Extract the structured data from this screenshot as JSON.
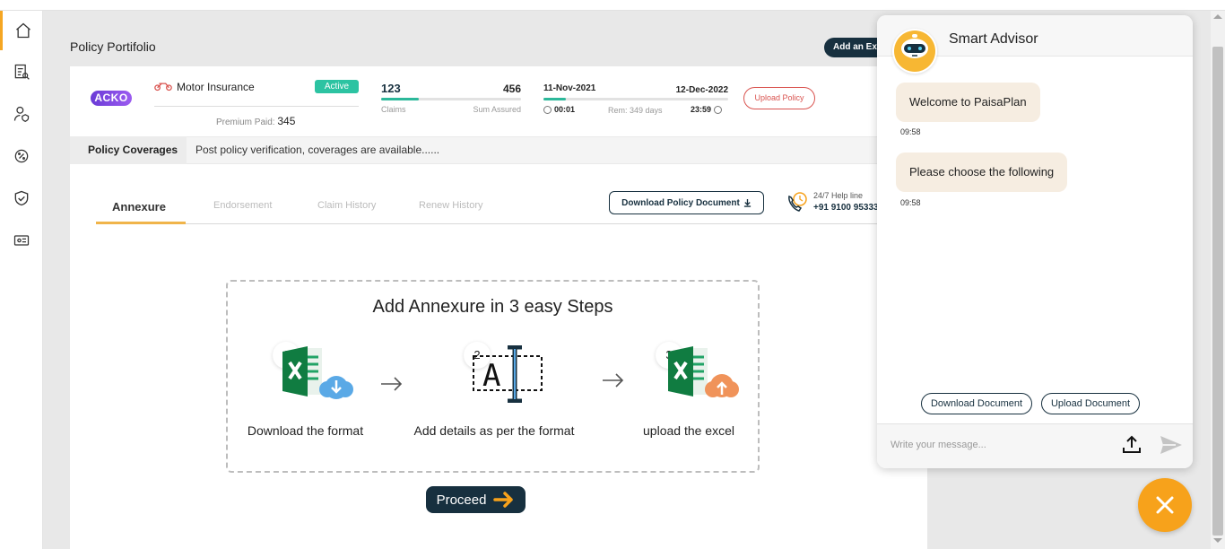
{
  "header": {
    "title": "Policy Portifolio",
    "add_existing_label": "Add an Existing Policy"
  },
  "sidebar": {
    "items": [
      {
        "name": "home-icon",
        "active": true
      },
      {
        "name": "report-icon",
        "active": false
      },
      {
        "name": "user-shield-icon",
        "active": false
      },
      {
        "name": "settings-percent-icon",
        "active": false
      },
      {
        "name": "shield-check-icon",
        "active": false
      },
      {
        "name": "id-card-icon",
        "active": false
      }
    ]
  },
  "policy": {
    "insurer": "ACKO",
    "type": "Motor Insurance",
    "status": "Active",
    "premium_label": "Premium Paid:",
    "premium_value": "345",
    "claims_value": "123",
    "claims_label": "Claims",
    "sum_value": "456",
    "sum_label": "Sum Assured",
    "claims_progress": 0.27,
    "start_date": "11-Nov-2021",
    "end_date": "12-Dec-2022",
    "start_time": "00:01",
    "remaining": "Rem: 349 days",
    "end_time": "23:59",
    "date_progress": 0.12,
    "upload_label": "Upload Policy"
  },
  "coverage": {
    "label": "Policy Coverages",
    "text": "Post policy verification, coverages are available......"
  },
  "tabs": [
    {
      "label": "Annexure",
      "active": true
    },
    {
      "label": "Endorsement",
      "active": false
    },
    {
      "label": "Claim History",
      "active": false
    },
    {
      "label": "Renew History",
      "active": false
    }
  ],
  "download_doc_label": "Download Policy Document",
  "helpline": {
    "label": "24/7 Help line",
    "number": "+91 9100 95333"
  },
  "annexure": {
    "title": "Add Annexure in 3 easy Steps",
    "steps": [
      {
        "num": "1",
        "label": "Download the format"
      },
      {
        "num": "2",
        "label": "Add details as per the format"
      },
      {
        "num": "3",
        "label": "upload the excel"
      }
    ],
    "proceed_label": "Proceed"
  },
  "chat": {
    "title": "Smart Advisor",
    "messages": [
      {
        "text": "Welcome to PaisaPlan",
        "time": "09:58"
      },
      {
        "text": "Please choose the following",
        "time": "09:58"
      }
    ],
    "options": [
      "Download Document",
      "Upload Document"
    ],
    "input_placeholder": "Write your message..."
  },
  "colors": {
    "accent": "#f7a21b",
    "dark": "#17303f",
    "teal": "#2cc3a2",
    "bubble": "#f6ede1"
  }
}
